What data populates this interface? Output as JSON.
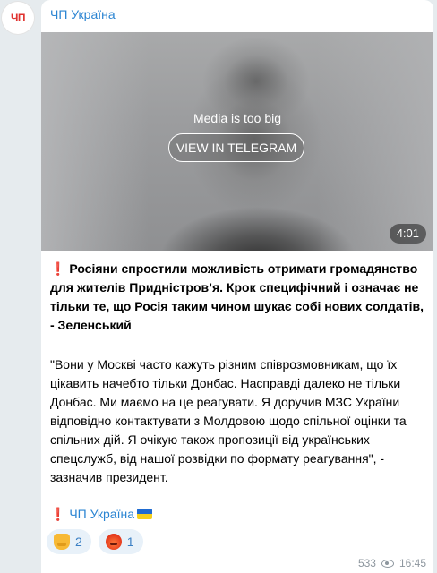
{
  "channel": {
    "avatar_text": "ЧП",
    "name": "ЧП Україна"
  },
  "media": {
    "message": "Media is too big",
    "button_label": "VIEW IN TELEGRAM",
    "duration": "4:01"
  },
  "post": {
    "headline_marker": "❗",
    "headline": " Росіяни спростили можливість отримати громадянство для жителів Придністров’я. Крок специфічний і означає не тільки те, що Росія таким чином шукає собі нових солдатів, - Зеленський",
    "quote": "\"Вони у Москві часто кажуть різним співрозмовникам, що їх цікавить начебто тільки Донбас. Насправді далеко не тільки Донбас. Ми маємо на це реагувати. Я доручив МЗС України відповідно контактувати з Молдовою щодо спільної оцінки та спільних дій. Я очікую також пропозиції від українських спецслужб, від нашої розвідки по формату реагування\", - зазначив президент.",
    "signature_marker": "❗",
    "signature_link": "ЧП Україна"
  },
  "reactions": [
    {
      "icon": "thumbs-down-emoji",
      "count": "2"
    },
    {
      "icon": "angry-face-emoji",
      "count": "1"
    }
  ],
  "meta": {
    "views": "533",
    "time": "16:45"
  },
  "colors": {
    "link": "#2a84d2",
    "background": "#e6ebee",
    "bubble": "#ffffff",
    "reaction_bg": "#e8f1f9"
  }
}
